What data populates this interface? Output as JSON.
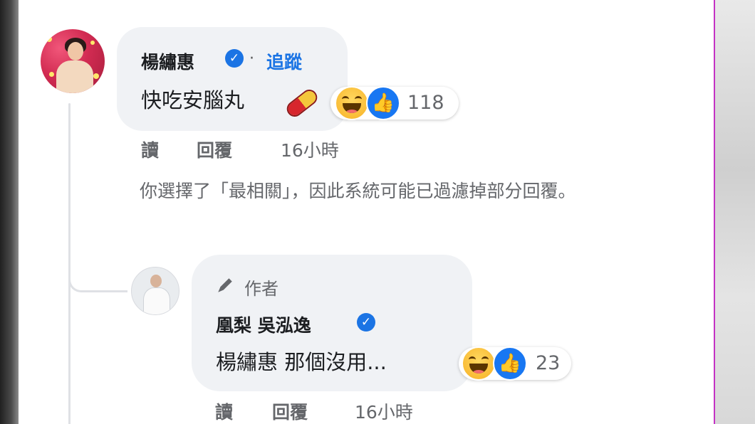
{
  "comment": {
    "author": "楊繡惠",
    "follow_label": "追蹤",
    "separator": "·",
    "text": "快吃安腦丸",
    "reaction_count": "118",
    "actions": {
      "like": "讀",
      "reply": "回覆",
      "time": "16小時"
    }
  },
  "notice_text": "你選擇了「最相關」，因此系統可能已過濾掉部分回覆。",
  "reply": {
    "badge_label": "作者",
    "author": "凰梨 吳泓逸",
    "text": "楊繡惠 那個沒用...",
    "reaction_count": "23",
    "actions": {
      "like": "讀",
      "reply": "回覆",
      "time": "16小時"
    }
  },
  "colors": {
    "verified": "#1b74e4",
    "follow": "#1b74e4",
    "like_reaction": "#1877f2",
    "haha_reaction": "#f7b125"
  },
  "icons": [
    "verified-icon",
    "pill-emoji-icon",
    "haha-reaction-icon",
    "like-reaction-icon",
    "pen-icon"
  ]
}
